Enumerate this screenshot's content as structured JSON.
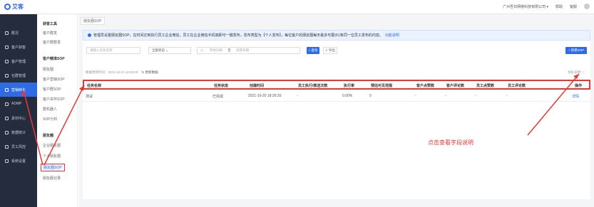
{
  "header": {
    "logo_text": "艾客",
    "company": "广州吾日网络科技有限公司 ▾",
    "help": "帮助",
    "notify": "客服"
  },
  "sidebar": {
    "items": [
      {
        "label": "概况",
        "icon": "home-icon"
      },
      {
        "label": "客户获客",
        "icon": "user-plus-icon"
      },
      {
        "label": "客户管理",
        "icon": "users-icon"
      },
      {
        "label": "社群管理",
        "icon": "group-icon"
      },
      {
        "label": "营销转化",
        "icon": "target-icon",
        "active": true
      },
      {
        "label": "ADMP",
        "icon": "database-icon"
      },
      {
        "label": "素材中心",
        "icon": "folder-icon"
      },
      {
        "label": "数据统计",
        "icon": "chart-icon"
      },
      {
        "label": "员工风控",
        "icon": "shield-icon"
      },
      {
        "label": "系统设置",
        "icon": "gear-icon"
      }
    ]
  },
  "submenu": {
    "groups": [
      {
        "title": "获客工具",
        "items": [
          "客户群发",
          "客户群群发"
        ]
      },
      {
        "title": "客户精准SOP",
        "items": [
          "朋友圈",
          "客户营销SOP",
          "客户群SOP",
          "客户关怀SOP",
          "群机器人",
          "SOP分析"
        ]
      },
      {
        "title": "朋友圈",
        "items": [
          "企业朋友圈",
          "个人朋友圈",
          "朋友圈SOP",
          "朋友圈记录"
        ]
      }
    ],
    "selected": "朋友圈SOP"
  },
  "tab": "朋友圈SOP",
  "notice": {
    "text": "管理员设置朋友圈SOP，在时间达到执行员工企业微信，员工在企业微信手机端即可一键发布。发布类型为【个人发布】，每位客户的朋友圈每天最多可展示1条同一位员工发布的内容。",
    "link": "功能说明"
  },
  "filters": {
    "task_name_placeholder": "请输入任务名称",
    "status_value": "全部状态",
    "start_placeholder": "开始日期",
    "range_sep": "至",
    "end_placeholder": "结束日期",
    "search_label": "查询",
    "export_label": "导出",
    "create_label": "+ 新建SOP"
  },
  "meta": {
    "update_text": "数据更新时间：2021-10-21 16:00:00",
    "refresh_label": "更新数据"
  },
  "col_hint": "指标说明 ⓘ",
  "table": {
    "headers": [
      "任务名称",
      "任务状态",
      "创建时间",
      "员工执行/推送次数",
      "执行率",
      "预估可见范围",
      "客户点赞数",
      "客户评论数",
      "员工点赞数",
      "员工评论数",
      "操作"
    ],
    "rows": [
      {
        "name": "测试",
        "status": "已完成",
        "created": "2021-10-20 18:26:20",
        "exec": "-",
        "rate": "0.00%",
        "range": "0",
        "c_like": "-",
        "c_comment": "-",
        "e_like": "-",
        "e_comment": "-",
        "action": "详情"
      }
    ]
  },
  "annotation": "点击查看字段说明"
}
